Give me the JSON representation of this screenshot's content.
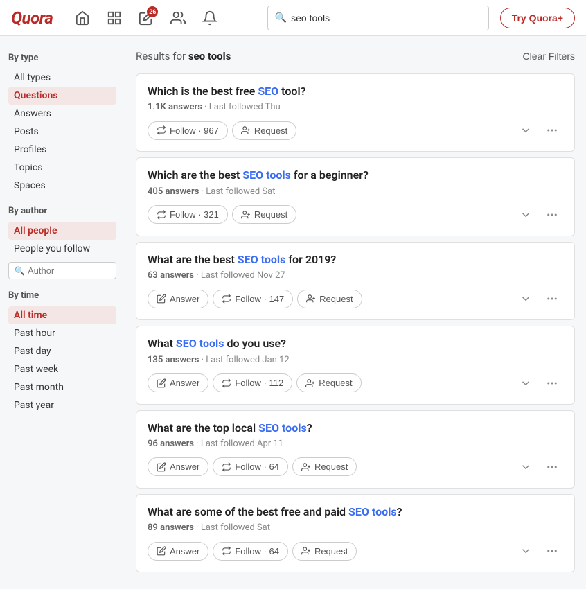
{
  "header": {
    "logo": "Quora",
    "search_placeholder": "seo tools",
    "search_value": "seo tools",
    "try_plus_label": "Try Quora+",
    "notifications_badge": "26"
  },
  "sidebar": {
    "by_type_label": "By type",
    "type_items": [
      {
        "id": "all-types",
        "label": "All types",
        "active": false
      },
      {
        "id": "questions",
        "label": "Questions",
        "active": true
      },
      {
        "id": "answers",
        "label": "Answers",
        "active": false
      },
      {
        "id": "posts",
        "label": "Posts",
        "active": false
      },
      {
        "id": "profiles",
        "label": "Profiles",
        "active": false
      },
      {
        "id": "topics",
        "label": "Topics",
        "active": false
      },
      {
        "id": "spaces",
        "label": "Spaces",
        "active": false
      }
    ],
    "by_author_label": "By author",
    "author_items": [
      {
        "id": "all-people",
        "label": "All people",
        "active": true
      },
      {
        "id": "people-you-follow",
        "label": "People you follow",
        "active": false
      }
    ],
    "author_search_placeholder": "Author",
    "by_time_label": "By time",
    "time_items": [
      {
        "id": "all-time",
        "label": "All time",
        "active": true
      },
      {
        "id": "past-hour",
        "label": "Past hour",
        "active": false
      },
      {
        "id": "past-day",
        "label": "Past day",
        "active": false
      },
      {
        "id": "past-week",
        "label": "Past week",
        "active": false
      },
      {
        "id": "past-month",
        "label": "Past month",
        "active": false
      },
      {
        "id": "past-year",
        "label": "Past year",
        "active": false
      }
    ]
  },
  "results": {
    "prefix": "Results for",
    "query": "seo tools",
    "clear_filters": "Clear Filters",
    "questions": [
      {
        "id": "q1",
        "title_parts": [
          {
            "text": "Which is the best free ",
            "highlight": false
          },
          {
            "text": "SEO",
            "highlight": true
          },
          {
            "text": " tool?",
            "highlight": false
          }
        ],
        "title_plain": "Which is the best free SEO tool?",
        "answers": "1.1K answers",
        "last_followed": "Last followed Thu",
        "show_answer": false,
        "follow_count": "967",
        "actions": [
          "follow",
          "request"
        ]
      },
      {
        "id": "q2",
        "title_parts": [
          {
            "text": "Which are the best ",
            "highlight": false
          },
          {
            "text": "SEO tools",
            "highlight": true
          },
          {
            "text": " for a beginner?",
            "highlight": false
          }
        ],
        "title_plain": "Which are the best SEO tools for a beginner?",
        "answers": "405 answers",
        "last_followed": "Last followed Sat",
        "show_answer": false,
        "follow_count": "321",
        "actions": [
          "follow",
          "request"
        ]
      },
      {
        "id": "q3",
        "title_parts": [
          {
            "text": "What are the best ",
            "highlight": false
          },
          {
            "text": "SEO tools",
            "highlight": true
          },
          {
            "text": " for 2019?",
            "highlight": false
          }
        ],
        "title_plain": "What are the best SEO tools for 2019?",
        "answers": "63 answers",
        "last_followed": "Last followed Nov 27",
        "show_answer": true,
        "follow_count": "147",
        "actions": [
          "answer",
          "follow",
          "request"
        ]
      },
      {
        "id": "q4",
        "title_parts": [
          {
            "text": "What ",
            "highlight": false
          },
          {
            "text": "SEO tools",
            "highlight": true
          },
          {
            "text": " do you use?",
            "highlight": false
          }
        ],
        "title_plain": "What SEO tools do you use?",
        "answers": "135 answers",
        "last_followed": "Last followed Jan 12",
        "show_answer": true,
        "follow_count": "112",
        "actions": [
          "answer",
          "follow",
          "request"
        ]
      },
      {
        "id": "q5",
        "title_parts": [
          {
            "text": "What are the top local ",
            "highlight": false
          },
          {
            "text": "SEO tools",
            "highlight": true
          },
          {
            "text": "?",
            "highlight": false
          }
        ],
        "title_plain": "What are the top local SEO tools?",
        "answers": "96 answers",
        "last_followed": "Last followed Apr 11",
        "show_answer": true,
        "follow_count": "64",
        "actions": [
          "answer",
          "follow",
          "request"
        ]
      },
      {
        "id": "q6",
        "title_parts": [
          {
            "text": "What are some of the best free and paid ",
            "highlight": false
          },
          {
            "text": "SEO tools",
            "highlight": true
          },
          {
            "text": "?",
            "highlight": false
          }
        ],
        "title_plain": "What are some of the best free and paid SEO tools?",
        "answers": "89 answers",
        "last_followed": "Last followed Sat",
        "show_answer": true,
        "follow_count": "64",
        "actions": [
          "answer",
          "follow",
          "request"
        ]
      }
    ],
    "labels": {
      "follow": "Follow",
      "request": "Request",
      "answer": "Answer"
    }
  }
}
